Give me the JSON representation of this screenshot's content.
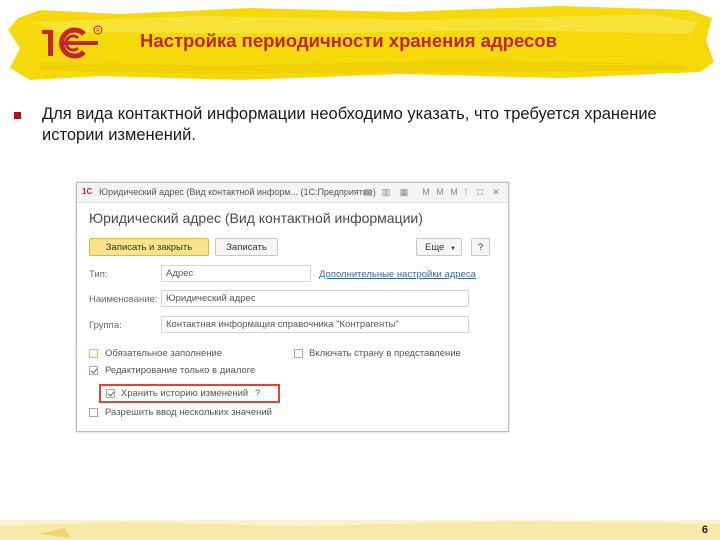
{
  "slide": {
    "title": "Настройка периодичности хранения адресов",
    "bullet": "Для вида контактной информации необходимо указать, что требуется хранение истории изменений.",
    "page_number": "6"
  },
  "window": {
    "title": "Юридический адрес (Вид контактной информ... (1С:Предприятие)",
    "form_title": "Юридический адрес (Вид контактной информации)",
    "toolbar": {
      "save_close": "Записать и закрыть",
      "save": "Записать",
      "more": "Еще",
      "help": "?"
    },
    "fields": {
      "type_label": "Тип:",
      "type_value": "Адрес",
      "extra_settings_link": "Дополнительные настройки адреса",
      "name_label": "Наименование:",
      "name_value": "Юридический адрес",
      "group_label": "Группа:",
      "group_value": "Контактная информация справочника \"Контрагенты\""
    },
    "checkboxes": {
      "required": "Обязательное заполнение",
      "include_country": "Включать страну в представление",
      "edit_dialog_only": "Редактирование только в диалоге",
      "store_history": "Хранить историю изменений",
      "store_history_hint": "?",
      "allow_multiple": "Разрешить ввод нескольких значений"
    }
  },
  "colors": {
    "title_red": "#c0262c",
    "banner_yellow": "#f5d90a",
    "primary_button": "#fbe38a",
    "highlight": "#e0433a"
  }
}
